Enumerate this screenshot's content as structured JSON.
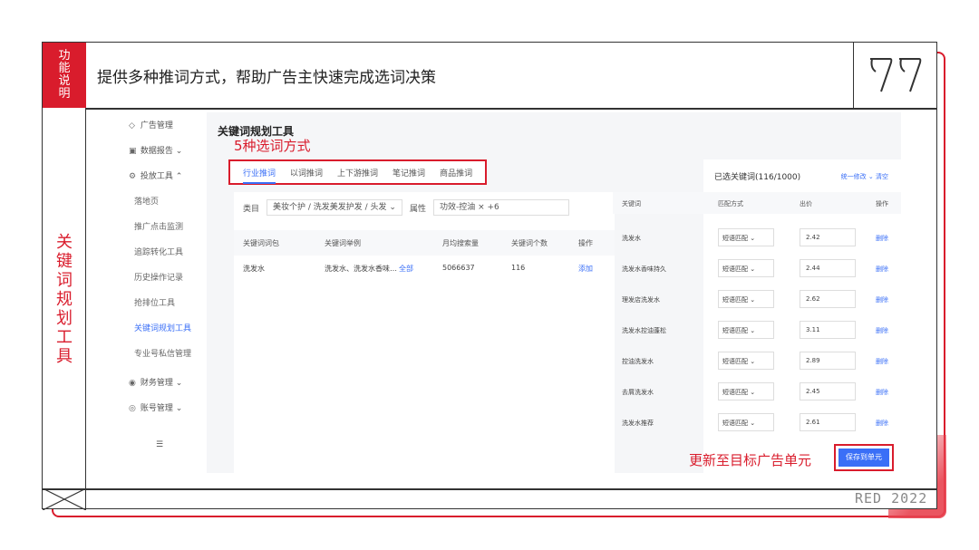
{
  "card": {
    "tag_top": [
      "功",
      "能",
      "说",
      "明"
    ],
    "tag_side": [
      "关",
      "键",
      "词",
      "规",
      "划",
      "工",
      "具"
    ],
    "headline": "提供多种推词方式，帮助广告主快速完成选词决策",
    "footer_brand": "RED 2022"
  },
  "sidebar": {
    "items": [
      {
        "label": "广告管理",
        "icon": "compass-icon"
      },
      {
        "label": "数据报告",
        "icon": "report-icon"
      },
      {
        "label": "投放工具",
        "icon": "tool-icon"
      }
    ],
    "sub_items": [
      "落地页",
      "推广点击监测",
      "追踪转化工具",
      "历史操作记录",
      "抢排位工具",
      "关键词规划工具",
      "专业号私信管理"
    ],
    "bottom_items": [
      {
        "label": "财务管理",
        "icon": "finance-icon"
      },
      {
        "label": "账号管理",
        "icon": "account-icon"
      }
    ],
    "collapse_icon": "collapse-menu-icon"
  },
  "main": {
    "title": "关键词规划工具",
    "annotation_methods": "5种选词方式",
    "tabs": [
      "行业推词",
      "以词推词",
      "上下游推词",
      "笔记推词",
      "商品推词"
    ],
    "filter": {
      "category_label": "类目",
      "category_value": "美妆个护 / 洗发美发护发 / 头发",
      "attr_label": "属性",
      "attr_value": "功效-控油 ×",
      "attr_more": "+6"
    },
    "table": {
      "headers": [
        "关键词词包",
        "关键词举例",
        "月均搜索量",
        "关键词个数",
        "操作"
      ],
      "rows": [
        {
          "pack": "洗发水",
          "example": "洗发水、洗发水香味…",
          "all": "全部",
          "volume": "5066637",
          "count": "116",
          "action": "添加"
        }
      ]
    }
  },
  "selected": {
    "title": "已选关键词(116/1000)",
    "link_bulk": "统一修改",
    "link_clear": "清空",
    "headers": [
      "关键词",
      "匹配方式",
      "出价",
      "操作"
    ],
    "rows": [
      {
        "kw": "洗发水",
        "match": "短语匹配",
        "bid": "2.42",
        "del": "删除"
      },
      {
        "kw": "洗发水香味持久",
        "match": "短语匹配",
        "bid": "2.44",
        "del": "删除"
      },
      {
        "kw": "理发店洗发水",
        "match": "短语匹配",
        "bid": "2.62",
        "del": "删除"
      },
      {
        "kw": "洗发水控油蓬松",
        "match": "短语匹配",
        "bid": "3.11",
        "del": "删除"
      },
      {
        "kw": "控油洗发水",
        "match": "短语匹配",
        "bid": "2.89",
        "del": "删除"
      },
      {
        "kw": "去屑洗发水",
        "match": "短语匹配",
        "bid": "2.45",
        "del": "删除"
      },
      {
        "kw": "洗发水推荐",
        "match": "短语匹配",
        "bid": "2.61",
        "del": "删除"
      }
    ],
    "annotation_update": "更新至目标广告单元",
    "save_label": "保存到单元"
  },
  "colors": {
    "accent_red": "#d91c2c",
    "link_blue": "#3a6ff7"
  }
}
